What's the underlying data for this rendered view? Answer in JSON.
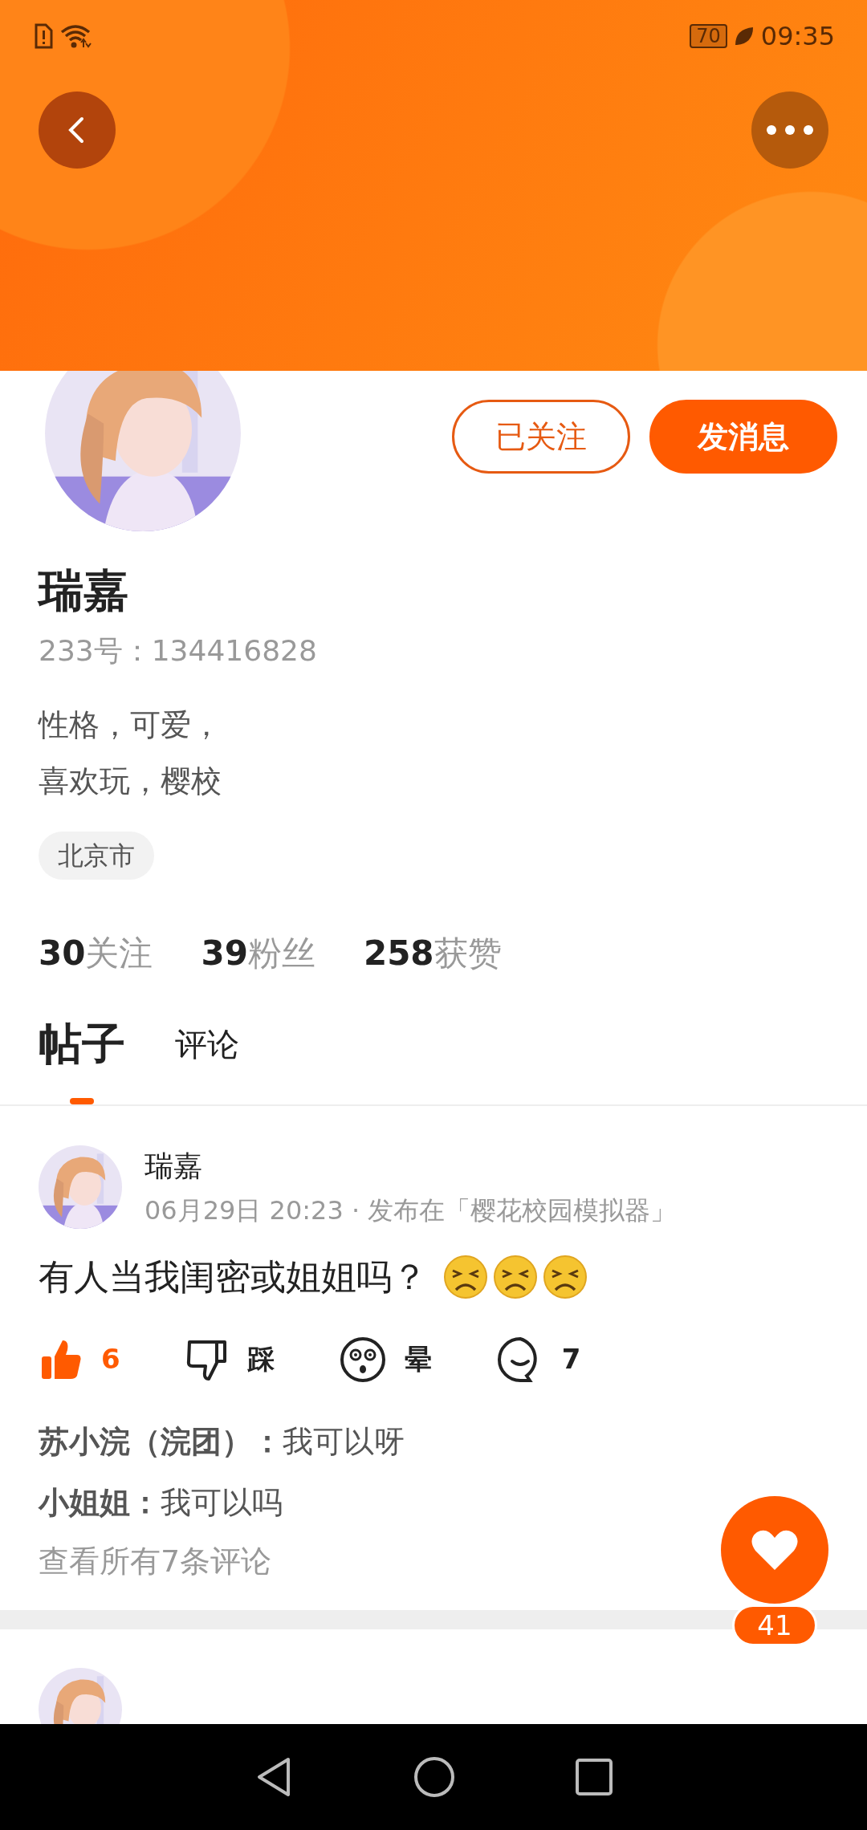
{
  "status_bar": {
    "battery": "70",
    "time": "09:35"
  },
  "profile": {
    "name": "瑞嘉",
    "id_line": "233号：134416828",
    "bio": [
      "性格，可爱，",
      "喜欢玩，樱校"
    ],
    "location": "北京市",
    "buttons": [
      {
        "label": "已关注",
        "kind": "outline"
      },
      {
        "label": "发消息",
        "kind": "filled"
      }
    ],
    "stats": [
      {
        "count": "30",
        "label": "关注"
      },
      {
        "count": "39",
        "label": "粉丝"
      },
      {
        "count": "258",
        "label": "获赞"
      }
    ]
  },
  "tabs": [
    {
      "label": "帖子",
      "selected": true
    },
    {
      "label": "评论",
      "selected": false
    }
  ],
  "posts": [
    {
      "author": "瑞嘉",
      "meta": "06月29日 20:23 · 发布在「樱花校园模拟器」",
      "text": "有人当我闺密或姐姐吗？",
      "emojis": [
        {
          "kind": "persevering"
        },
        {
          "kind": "persevering"
        },
        {
          "kind": "persevering"
        }
      ],
      "actions": [
        {
          "kind": "like",
          "label": "6",
          "on": true
        },
        {
          "kind": "dislike",
          "label": "踩",
          "on": false
        },
        {
          "kind": "dizzy",
          "label": "晕",
          "on": false
        },
        {
          "kind": "comment",
          "label": "7",
          "on": false
        }
      ],
      "comments": [
        "**苏小浣（浣团）：**我可以呀",
        "**小姐姐：**我可以吗"
      ],
      "view_all": "查看所有7条评论"
    }
  ],
  "fab": {
    "count": "41"
  }
}
